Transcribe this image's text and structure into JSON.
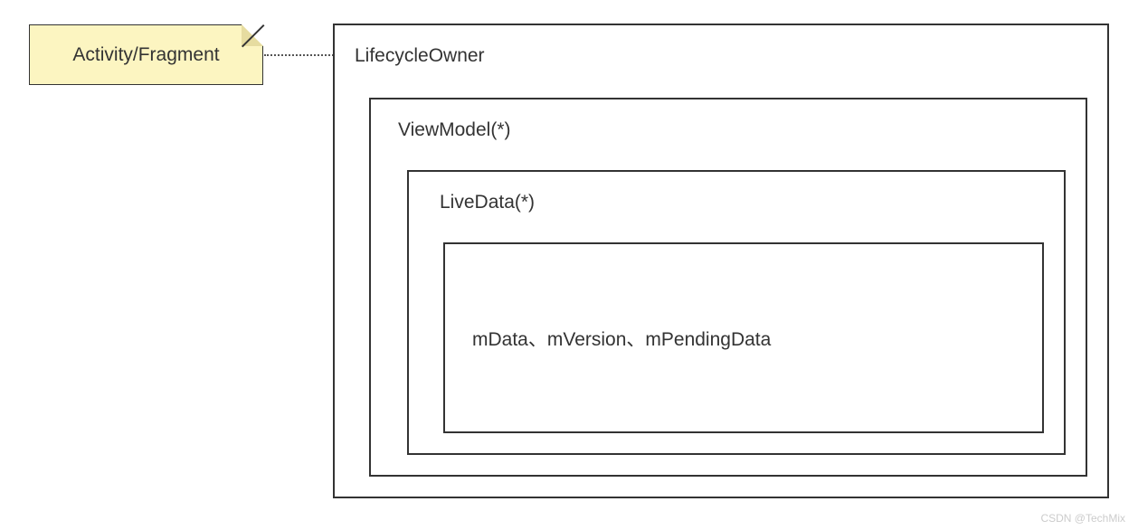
{
  "note": {
    "label": "Activity/Fragment"
  },
  "lifecycleOwner": {
    "label": "LifecycleOwner"
  },
  "viewModel": {
    "label": "ViewModel(*)"
  },
  "liveData": {
    "label": "LiveData(*)"
  },
  "innerFields": {
    "label": "mData、mVersion、mPendingData"
  },
  "watermark": {
    "text": "CSDN @TechMix"
  }
}
